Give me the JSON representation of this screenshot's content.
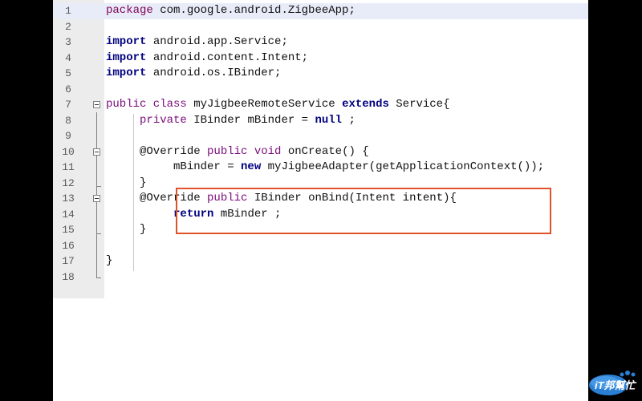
{
  "lines": [
    {
      "n": "1",
      "segs": [
        {
          "t": "package",
          "c": "kw2"
        },
        {
          "t": " com.google.android.ZigbeeApp;",
          "c": "pl"
        }
      ]
    },
    {
      "n": "2",
      "segs": []
    },
    {
      "n": "3",
      "segs": [
        {
          "t": "import",
          "c": "kw"
        },
        {
          "t": " android.app.Service;",
          "c": "pl"
        }
      ]
    },
    {
      "n": "4",
      "segs": [
        {
          "t": "import",
          "c": "kw"
        },
        {
          "t": " android.content.Intent;",
          "c": "pl"
        }
      ]
    },
    {
      "n": "5",
      "segs": [
        {
          "t": "import",
          "c": "kw"
        },
        {
          "t": " android.os.IBinder;",
          "c": "pl"
        }
      ]
    },
    {
      "n": "6",
      "segs": []
    },
    {
      "n": "7",
      "segs": [
        {
          "t": "public class",
          "c": "mod"
        },
        {
          "t": " myJigbeeRemoteService ",
          "c": "pl"
        },
        {
          "t": "extends",
          "c": "kw"
        },
        {
          "t": " Service{",
          "c": "pl"
        }
      ]
    },
    {
      "n": "8",
      "segs": [
        {
          "t": "     ",
          "c": "pl"
        },
        {
          "t": "private",
          "c": "mod"
        },
        {
          "t": " IBinder mBinder = ",
          "c": "pl"
        },
        {
          "t": "null",
          "c": "kw"
        },
        {
          "t": " ;",
          "c": "pl"
        }
      ]
    },
    {
      "n": "9",
      "segs": []
    },
    {
      "n": "10",
      "segs": [
        {
          "t": "     @Override ",
          "c": "pl"
        },
        {
          "t": "public void",
          "c": "mod"
        },
        {
          "t": " onCreate() {",
          "c": "pl"
        }
      ]
    },
    {
      "n": "11",
      "segs": [
        {
          "t": "          mBinder = ",
          "c": "pl"
        },
        {
          "t": "new",
          "c": "kw"
        },
        {
          "t": " myJigbeeAdapter(getApplicationContext());",
          "c": "pl"
        }
      ]
    },
    {
      "n": "12",
      "segs": [
        {
          "t": "     }",
          "c": "pl"
        }
      ]
    },
    {
      "n": "13",
      "segs": [
        {
          "t": "     @Override ",
          "c": "pl"
        },
        {
          "t": "public",
          "c": "mod"
        },
        {
          "t": " IBinder onBind(Intent intent){",
          "c": "pl"
        }
      ]
    },
    {
      "n": "14",
      "segs": [
        {
          "t": "          ",
          "c": "pl"
        },
        {
          "t": "return",
          "c": "kw"
        },
        {
          "t": " mBinder ;",
          "c": "pl"
        }
      ]
    },
    {
      "n": "15",
      "segs": [
        {
          "t": "     }",
          "c": "pl"
        }
      ]
    },
    {
      "n": "16",
      "segs": []
    },
    {
      "n": "17",
      "segs": [
        {
          "t": "}",
          "c": "pl"
        }
      ]
    },
    {
      "n": "18",
      "segs": []
    }
  ],
  "current_line": "1",
  "watermark": {
    "text": "iT邦幫忙"
  },
  "colors": {
    "highlight_box": "#e0522a",
    "keyword": "#000080",
    "modifier": "#7a0a7a",
    "current_line_bg": "#e8ecf8",
    "gutter_bg": "#ececec"
  }
}
